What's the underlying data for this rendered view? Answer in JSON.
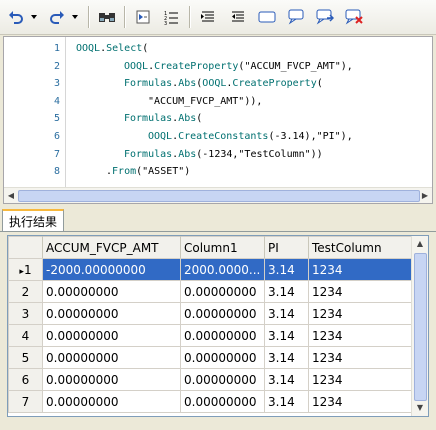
{
  "toolbar": {
    "buttons": [
      "undo-icon",
      "redo-icon",
      "find-icon",
      "indent-icon",
      "list-icon",
      "align-left-icon",
      "align-center-icon",
      "rectangle-icon",
      "comment-icon",
      "comment-arrow-icon",
      "comment-delete-icon"
    ]
  },
  "editor": {
    "line_numbers": [
      "1",
      "2",
      "3",
      "4",
      "5",
      "6",
      "7",
      "8"
    ],
    "lines": [
      {
        "indent": "OOQL.Select(",
        "parts": [
          [
            "kw",
            "OOQL"
          ],
          [
            "plain",
            "."
          ],
          [
            "kw",
            "Select"
          ],
          [
            "plain",
            "("
          ]
        ],
        "offset": 0
      },
      {
        "parts": [
          [
            "kw",
            "OOQL"
          ],
          [
            "plain",
            "."
          ],
          [
            "kw",
            "CreateProperty"
          ],
          [
            "plain",
            "(\"ACCUM_FVCP_AMT\"),"
          ]
        ],
        "offset": 48
      },
      {
        "parts": [
          [
            "kw",
            "Formulas"
          ],
          [
            "plain",
            "."
          ],
          [
            "kw",
            "Abs"
          ],
          [
            "plain",
            "("
          ],
          [
            "kw",
            "OOQL"
          ],
          [
            "plain",
            "."
          ],
          [
            "kw",
            "CreateProperty"
          ],
          [
            "plain",
            "("
          ]
        ],
        "offset": 48
      },
      {
        "parts": [
          [
            "plain",
            "\"ACCUM_FVCP_AMT\")),"
          ]
        ],
        "offset": 72
      },
      {
        "parts": [
          [
            "kw",
            "Formulas"
          ],
          [
            "plain",
            "."
          ],
          [
            "kw",
            "Abs"
          ],
          [
            "plain",
            "("
          ]
        ],
        "offset": 48
      },
      {
        "parts": [
          [
            "kw",
            "OOQL"
          ],
          [
            "plain",
            "."
          ],
          [
            "kw",
            "CreateConstants"
          ],
          [
            "plain",
            "(-3.14),\"PI\"),"
          ]
        ],
        "offset": 72
      },
      {
        "parts": [
          [
            "kw",
            "Formulas"
          ],
          [
            "plain",
            "."
          ],
          [
            "kw",
            "Abs"
          ],
          [
            "plain",
            "(-1234,\"TestColumn\"))"
          ]
        ],
        "offset": 48
      },
      {
        "parts": [
          [
            "plain",
            "."
          ],
          [
            "kw",
            "From"
          ],
          [
            "plain",
            "(\"ASSET\")"
          ]
        ],
        "offset": 30
      }
    ]
  },
  "tab": {
    "label": "执行结果"
  },
  "grid": {
    "columns": [
      "ACCUM_FVCP_AMT",
      "Column1",
      "PI",
      "TestColumn"
    ],
    "rows": [
      {
        "num": "1",
        "indicator": "▸",
        "cells": [
          "-2000.00000000",
          "2000.0000...",
          "3.14",
          "1234"
        ]
      },
      {
        "num": "2",
        "indicator": "",
        "cells": [
          "0.00000000",
          "0.00000000",
          "3.14",
          "1234"
        ]
      },
      {
        "num": "3",
        "indicator": "",
        "cells": [
          "0.00000000",
          "0.00000000",
          "3.14",
          "1234"
        ]
      },
      {
        "num": "4",
        "indicator": "",
        "cells": [
          "0.00000000",
          "0.00000000",
          "3.14",
          "1234"
        ]
      },
      {
        "num": "5",
        "indicator": "",
        "cells": [
          "0.00000000",
          "0.00000000",
          "3.14",
          "1234"
        ]
      },
      {
        "num": "6",
        "indicator": "",
        "cells": [
          "0.00000000",
          "0.00000000",
          "3.14",
          "1234"
        ]
      },
      {
        "num": "7",
        "indicator": "",
        "cells": [
          "0.00000000",
          "0.00000000",
          "3.14",
          "1234"
        ]
      }
    ]
  }
}
